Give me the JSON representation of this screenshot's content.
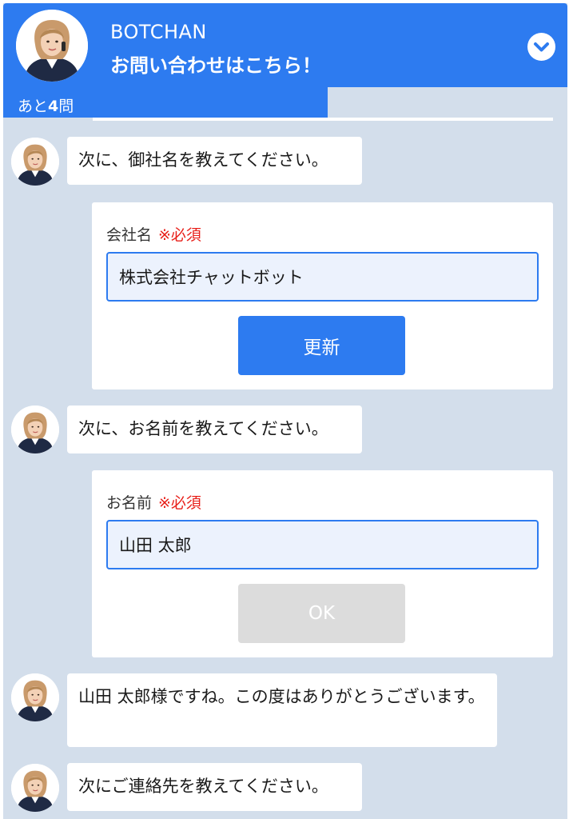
{
  "header": {
    "bot_name": "BOTCHAN",
    "subtitle": "お問い合わせはこちら！",
    "avatar_icon": "operator-avatar-icon",
    "collapse_icon": "chevron-down-icon"
  },
  "progress": {
    "prefix": "あと",
    "remaining": "4",
    "suffix": "問",
    "fill_fraction": 0.575
  },
  "messages": [
    {
      "text": "次に、御社名を教えてください。"
    },
    {
      "text": "次に、お名前を教えてください。"
    },
    {
      "text": "山田 太郎様ですね。この度はありがとうございます。"
    },
    {
      "text": "次にご連絡先を教えてください。"
    }
  ],
  "company_form": {
    "label": "会社名",
    "required": "※必須",
    "value": "株式会社チャットボット",
    "button_label": "更新"
  },
  "name_form": {
    "label": "お名前",
    "required": "※必須",
    "value": "山田 太郎",
    "button_label": "OK"
  },
  "colors": {
    "accent": "#2d7bf0",
    "background": "#d3deeb",
    "required": "#e8201a",
    "input_fill": "#ecf2fd",
    "disabled_button": "#dcdcdc"
  }
}
